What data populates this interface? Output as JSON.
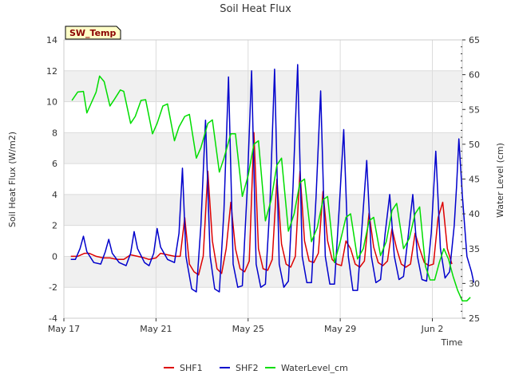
{
  "chart_data": {
    "type": "line",
    "title": "Soil Heat Flux",
    "xlabel": "Time",
    "ylabel": "Soil Heat Flux (W/m2)",
    "y2label": "Water Level (cm)",
    "badge": "SW_Temp",
    "x_start": "May 17",
    "xlim_days": [
      0,
      17.3
    ],
    "xticks": [
      {
        "label": "May 17",
        "day": 0
      },
      {
        "label": "May 21",
        "day": 4
      },
      {
        "label": "May 25",
        "day": 8
      },
      {
        "label": "May 29",
        "day": 12
      },
      {
        "label": "Jun 2",
        "day": 16
      }
    ],
    "ylim": [
      -4,
      14
    ],
    "yticks": [
      "-4",
      "-2",
      "0",
      "2",
      "4",
      "6",
      "8",
      "10",
      "12",
      "14"
    ],
    "y2lim": [
      25,
      65
    ],
    "y2ticks": [
      "25",
      "30",
      "35",
      "40",
      "45",
      "50",
      "55",
      "60",
      "65"
    ],
    "grid": true,
    "legend_position": "bottom",
    "series": [
      {
        "name": "SHF1",
        "axis": "left",
        "color": "#dd0000",
        "points": [
          [
            0.3,
            0.0
          ],
          [
            0.6,
            0.0
          ],
          [
            0.9,
            0.2
          ],
          [
            1.1,
            0.2
          ],
          [
            1.4,
            0.0
          ],
          [
            1.7,
            -0.1
          ],
          [
            2.0,
            -0.1
          ],
          [
            2.3,
            -0.2
          ],
          [
            2.6,
            -0.2
          ],
          [
            2.9,
            0.1
          ],
          [
            3.2,
            0.0
          ],
          [
            3.5,
            -0.1
          ],
          [
            3.7,
            -0.2
          ],
          [
            4.0,
            -0.1
          ],
          [
            4.2,
            0.2
          ],
          [
            4.5,
            0.1
          ],
          [
            4.8,
            0.0
          ],
          [
            5.05,
            0.0
          ],
          [
            5.25,
            2.5
          ],
          [
            5.45,
            -0.5
          ],
          [
            5.65,
            -1.0
          ],
          [
            5.85,
            -1.2
          ],
          [
            6.05,
            0.0
          ],
          [
            6.25,
            5.5
          ],
          [
            6.45,
            1.0
          ],
          [
            6.65,
            -0.8
          ],
          [
            6.85,
            -1.1
          ],
          [
            7.05,
            0.5
          ],
          [
            7.25,
            3.5
          ],
          [
            7.45,
            0.5
          ],
          [
            7.65,
            -0.8
          ],
          [
            7.85,
            -1.0
          ],
          [
            8.05,
            -0.3
          ],
          [
            8.25,
            8.0
          ],
          [
            8.45,
            0.5
          ],
          [
            8.65,
            -0.8
          ],
          [
            8.85,
            -0.9
          ],
          [
            9.05,
            -0.2
          ],
          [
            9.25,
            5.0
          ],
          [
            9.45,
            0.8
          ],
          [
            9.65,
            -0.5
          ],
          [
            9.85,
            -0.7
          ],
          [
            10.05,
            0.0
          ],
          [
            10.25,
            5.5
          ],
          [
            10.45,
            1.0
          ],
          [
            10.65,
            -0.3
          ],
          [
            10.85,
            -0.4
          ],
          [
            11.05,
            0.2
          ],
          [
            11.25,
            4.2
          ],
          [
            11.45,
            1.0
          ],
          [
            11.65,
            -0.2
          ],
          [
            11.85,
            -0.5
          ],
          [
            12.05,
            -0.6
          ],
          [
            12.25,
            1.0
          ],
          [
            12.45,
            0.5
          ],
          [
            12.65,
            -0.5
          ],
          [
            12.85,
            -0.7
          ],
          [
            13.05,
            -0.3
          ],
          [
            13.25,
            2.8
          ],
          [
            13.45,
            0.6
          ],
          [
            13.65,
            -0.4
          ],
          [
            13.85,
            -0.6
          ],
          [
            14.05,
            -0.3
          ],
          [
            14.25,
            1.8
          ],
          [
            14.45,
            0.5
          ],
          [
            14.65,
            -0.5
          ],
          [
            14.85,
            -0.7
          ],
          [
            15.05,
            -0.5
          ],
          [
            15.25,
            1.5
          ],
          [
            15.45,
            0.5
          ],
          [
            15.65,
            -0.4
          ],
          [
            15.85,
            -0.6
          ],
          [
            16.05,
            -0.5
          ],
          [
            16.25,
            2.5
          ],
          [
            16.45,
            3.5
          ],
          [
            16.65,
            0.5
          ],
          [
            16.85,
            -0.5
          ]
        ]
      },
      {
        "name": "SHF2",
        "axis": "left",
        "color": "#0000cc",
        "points": [
          [
            0.3,
            -0.2
          ],
          [
            0.5,
            -0.2
          ],
          [
            0.7,
            0.5
          ],
          [
            0.85,
            1.3
          ],
          [
            1.0,
            0.3
          ],
          [
            1.3,
            -0.4
          ],
          [
            1.6,
            -0.5
          ],
          [
            1.8,
            0.3
          ],
          [
            1.95,
            1.1
          ],
          [
            2.1,
            0.2
          ],
          [
            2.4,
            -0.4
          ],
          [
            2.7,
            -0.6
          ],
          [
            2.9,
            0.2
          ],
          [
            3.05,
            1.6
          ],
          [
            3.2,
            0.5
          ],
          [
            3.5,
            -0.4
          ],
          [
            3.7,
            -0.6
          ],
          [
            3.9,
            0.2
          ],
          [
            4.05,
            1.8
          ],
          [
            4.2,
            0.6
          ],
          [
            4.5,
            -0.2
          ],
          [
            4.8,
            -0.4
          ],
          [
            5.0,
            1.5
          ],
          [
            5.15,
            5.7
          ],
          [
            5.3,
            0.0
          ],
          [
            5.55,
            -2.1
          ],
          [
            5.75,
            -2.3
          ],
          [
            5.95,
            2.0
          ],
          [
            6.15,
            8.8
          ],
          [
            6.35,
            0.0
          ],
          [
            6.55,
            -2.1
          ],
          [
            6.75,
            -2.3
          ],
          [
            6.95,
            3.0
          ],
          [
            7.15,
            11.6
          ],
          [
            7.35,
            -0.5
          ],
          [
            7.55,
            -2.0
          ],
          [
            7.75,
            -1.9
          ],
          [
            7.95,
            4.0
          ],
          [
            8.15,
            12.0
          ],
          [
            8.35,
            -0.5
          ],
          [
            8.55,
            -2.0
          ],
          [
            8.75,
            -1.8
          ],
          [
            8.95,
            3.5
          ],
          [
            9.15,
            12.1
          ],
          [
            9.35,
            -0.5
          ],
          [
            9.55,
            -2.0
          ],
          [
            9.75,
            -1.6
          ],
          [
            9.95,
            4.5
          ],
          [
            10.15,
            12.4
          ],
          [
            10.35,
            0.0
          ],
          [
            10.55,
            -1.7
          ],
          [
            10.75,
            -1.7
          ],
          [
            10.95,
            3.8
          ],
          [
            11.15,
            10.7
          ],
          [
            11.35,
            0.0
          ],
          [
            11.55,
            -1.8
          ],
          [
            11.75,
            -1.8
          ],
          [
            11.95,
            3.0
          ],
          [
            12.15,
            8.2
          ],
          [
            12.35,
            0.0
          ],
          [
            12.55,
            -2.2
          ],
          [
            12.75,
            -2.2
          ],
          [
            12.95,
            2.0
          ],
          [
            13.15,
            6.2
          ],
          [
            13.35,
            0.0
          ],
          [
            13.55,
            -1.7
          ],
          [
            13.75,
            -1.5
          ],
          [
            13.95,
            1.5
          ],
          [
            14.15,
            4.0
          ],
          [
            14.35,
            0.0
          ],
          [
            14.55,
            -1.5
          ],
          [
            14.75,
            -1.3
          ],
          [
            14.95,
            1.3
          ],
          [
            15.15,
            4.0
          ],
          [
            15.35,
            0.0
          ],
          [
            15.55,
            -1.5
          ],
          [
            15.75,
            -1.6
          ],
          [
            15.95,
            1.5
          ],
          [
            16.15,
            6.8
          ],
          [
            16.35,
            0.5
          ],
          [
            16.55,
            -1.4
          ],
          [
            16.75,
            -1.0
          ],
          [
            16.95,
            2.0
          ],
          [
            17.05,
            4.5
          ],
          [
            17.15,
            7.6
          ],
          [
            17.3,
            4.0
          ],
          [
            17.5,
            0.0
          ],
          [
            17.7,
            -1.0
          ],
          [
            17.8,
            -1.7
          ]
        ]
      },
      {
        "name": "WaterLevel_cm",
        "axis": "right",
        "color": "#00dd00",
        "points": [
          [
            0.35,
            56.3
          ],
          [
            0.6,
            57.5
          ],
          [
            0.85,
            57.6
          ],
          [
            1.0,
            54.5
          ],
          [
            1.2,
            56.0
          ],
          [
            1.4,
            57.5
          ],
          [
            1.55,
            59.8
          ],
          [
            1.75,
            59.0
          ],
          [
            2.0,
            55.5
          ],
          [
            2.2,
            56.5
          ],
          [
            2.45,
            57.8
          ],
          [
            2.6,
            57.6
          ],
          [
            2.9,
            53.0
          ],
          [
            3.1,
            54.0
          ],
          [
            3.35,
            56.3
          ],
          [
            3.55,
            56.4
          ],
          [
            3.85,
            51.5
          ],
          [
            4.05,
            53.0
          ],
          [
            4.3,
            55.5
          ],
          [
            4.5,
            55.8
          ],
          [
            4.8,
            50.5
          ],
          [
            5.0,
            52.5
          ],
          [
            5.25,
            54.0
          ],
          [
            5.45,
            54.3
          ],
          [
            5.75,
            48.0
          ],
          [
            5.95,
            49.5
          ],
          [
            6.25,
            53.0
          ],
          [
            6.45,
            53.5
          ],
          [
            6.75,
            46.0
          ],
          [
            6.95,
            48.0
          ],
          [
            7.25,
            51.5
          ],
          [
            7.45,
            51.5
          ],
          [
            7.75,
            42.5
          ],
          [
            8.0,
            45.5
          ],
          [
            8.25,
            50.0
          ],
          [
            8.45,
            50.5
          ],
          [
            8.75,
            39.0
          ],
          [
            9.0,
            42.0
          ],
          [
            9.25,
            47.0
          ],
          [
            9.45,
            48.0
          ],
          [
            9.75,
            37.5
          ],
          [
            10.0,
            40.0
          ],
          [
            10.25,
            44.5
          ],
          [
            10.45,
            45.0
          ],
          [
            10.75,
            36.0
          ],
          [
            11.0,
            38.0
          ],
          [
            11.25,
            42.0
          ],
          [
            11.45,
            42.5
          ],
          [
            11.75,
            33.0
          ],
          [
            12.0,
            36.0
          ],
          [
            12.25,
            39.5
          ],
          [
            12.45,
            40.0
          ],
          [
            12.75,
            33.5
          ],
          [
            13.0,
            35.0
          ],
          [
            13.25,
            39.0
          ],
          [
            13.45,
            39.5
          ],
          [
            13.75,
            34.0
          ],
          [
            14.0,
            36.0
          ],
          [
            14.25,
            40.5
          ],
          [
            14.45,
            41.5
          ],
          [
            14.75,
            35.0
          ],
          [
            15.0,
            36.5
          ],
          [
            15.25,
            40.0
          ],
          [
            15.45,
            41.0
          ],
          [
            15.7,
            32.5
          ],
          [
            15.9,
            30.5
          ],
          [
            16.1,
            30.5
          ],
          [
            16.3,
            33.0
          ],
          [
            16.5,
            35.0
          ],
          [
            16.7,
            33.5
          ],
          [
            16.9,
            31.0
          ],
          [
            17.1,
            29.0
          ],
          [
            17.3,
            27.5
          ],
          [
            17.5,
            27.5
          ],
          [
            17.65,
            28.0
          ]
        ]
      }
    ]
  }
}
